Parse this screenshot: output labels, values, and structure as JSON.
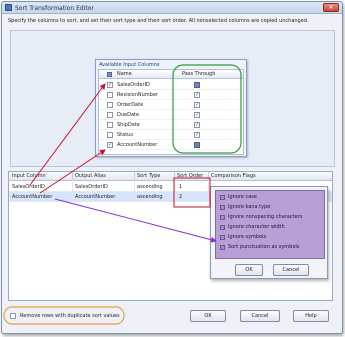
{
  "window": {
    "title": "Sort Transformation Editor",
    "close_glyph": "✕",
    "instruction": "Specify the columns to sort, and set their sort type and their sort order. All nonselected columns are copied unchanged."
  },
  "available_columns": {
    "title": "Available Input Columns",
    "header_name": "Name",
    "header_pass": "Pass Through",
    "rows": [
      {
        "name": "SalesOrderID",
        "checked": true,
        "pass_through": "dim"
      },
      {
        "name": "RevisionNumber",
        "checked": false,
        "pass_through": "checked"
      },
      {
        "name": "OrderDate",
        "checked": false,
        "pass_through": "checked"
      },
      {
        "name": "DueDate",
        "checked": false,
        "pass_through": "checked"
      },
      {
        "name": "ShipDate",
        "checked": false,
        "pass_through": "checked"
      },
      {
        "name": "Status",
        "checked": false,
        "pass_through": "checked"
      },
      {
        "name": "AccountNumber",
        "checked": true,
        "pass_through": "dim"
      }
    ]
  },
  "grid": {
    "headers": [
      "Input Column",
      "Output Alias",
      "Sort Type",
      "Sort Order",
      "Comparison Flags"
    ],
    "rows": [
      {
        "input": "SalesOrderID",
        "alias": "SalesOrderID",
        "type": "ascending",
        "order": "1",
        "flags": ""
      },
      {
        "input": "AccountNumber",
        "alias": "AccountNumber",
        "type": "ascending",
        "order": "2",
        "flags": ""
      }
    ],
    "combo_arrow": "▼"
  },
  "comparison_flags": {
    "options": [
      "Ignore case",
      "Ignore kana type",
      "Ignore nonspacing characters",
      "Ignore character width",
      "Ignore symbols",
      "Sort punctuation as symbols"
    ],
    "ok_label": "OK",
    "cancel_label": "Cancel"
  },
  "footer": {
    "remove_duplicates_label": "Remove rows with duplicate sort values",
    "ok_label": "OK",
    "cancel_label": "Cancel",
    "help_label": "Help"
  },
  "colors": {
    "green_outline": "#2e9a3a",
    "red_arrow": "#c8102e",
    "purple_arrow": "#8a2be2",
    "orange_outline": "#e8a040",
    "flags_highlight": "#b99fd8"
  }
}
